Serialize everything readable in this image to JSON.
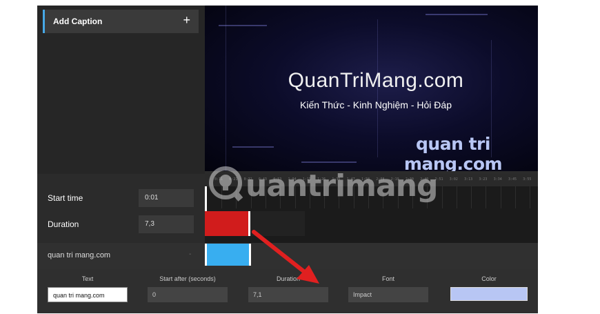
{
  "sidebar": {
    "add_caption_label": "Add Caption",
    "add_icon": "plus-icon"
  },
  "preview": {
    "title": "QuanTriMang.com",
    "subtitle": "Kiến Thức - Kinh Nghiệm - Hỏi Đáp",
    "caption": "quan tri mang.com"
  },
  "timeline": {
    "ticks": [
      "0:11",
      "0:21",
      "0:32",
      "0:43",
      "0:53",
      "1:04",
      "1:15",
      "1:26",
      "1:36",
      "1:47",
      "1:58",
      "2:08",
      "2:19",
      "2:30",
      "2:40",
      "2:51",
      "3:02",
      "3:13",
      "3:23",
      "3:34",
      "3:45",
      "3:55"
    ],
    "start_time_label": "Start time",
    "start_time_value": "0:01",
    "duration_label": "Duration",
    "duration_value": "7,3"
  },
  "caption_item": {
    "label": "quan tri mang.com",
    "chevron": "-"
  },
  "properties": {
    "text_label": "Text",
    "text_value": "quan tri mang.com",
    "start_after_label": "Start after (seconds)",
    "start_after_value": "0",
    "duration_label": "Duration",
    "duration_value": "7,1",
    "font_label": "Font",
    "font_value": "Impact",
    "color_label": "Color",
    "color_value": "#b8c6f4"
  },
  "watermark": {
    "text": "uantrimang",
    "icon": "lightbulb-icon"
  },
  "annotation": {
    "icon": "red-arrow-icon",
    "color": "#e02020"
  },
  "colors": {
    "accent": "#46a8e6",
    "clip_red": "#d11c1c",
    "clip_blue": "#38aef0"
  }
}
